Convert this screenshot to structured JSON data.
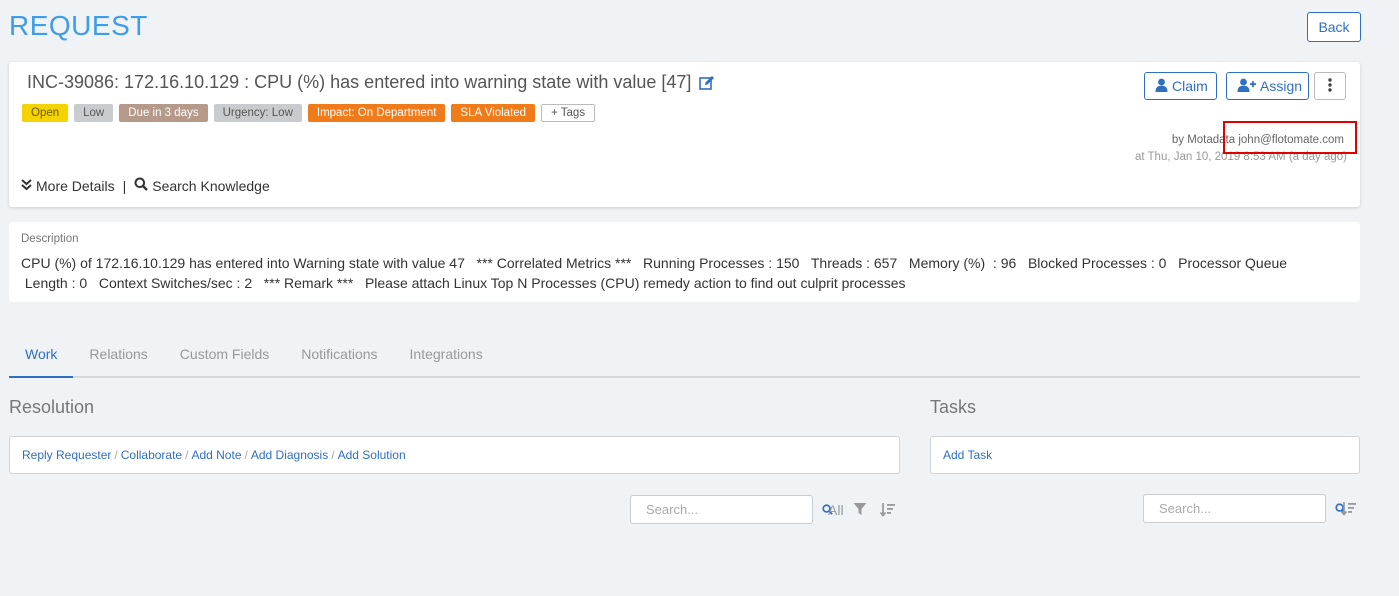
{
  "header": {
    "title": "REQUEST",
    "back_label": "Back"
  },
  "ticket": {
    "title": "INC-39086: 172.16.10.129 : CPU (%) has entered into warning state with value [47]",
    "badges": {
      "status": "Open",
      "priority": "Low",
      "due": "Due in 3 days",
      "urgency": "Urgency: Low",
      "impact": "Impact: On Department",
      "sla": "SLA Violated",
      "tags": "+ Tags"
    },
    "actions": {
      "claim": "Claim",
      "assign": "Assign"
    },
    "by_prefix": "by Motadata",
    "email": "john@flotomate.com",
    "timestamp": "at Thu, Jan 10, 2019 8:53 AM (a day ago)",
    "more_details": "More Details",
    "search_knowledge": "Search Knowledge"
  },
  "description": {
    "label": "Description",
    "text": "CPU (%) of 172.16.10.129 has entered into Warning state with value 47   *** Correlated Metrics ***   Running Processes : 150   Threads : 657   Memory (%)  : 96   Blocked Processes : 0   Processor Queue\n Length : 0   Context Switches/sec : 2   *** Remark ***   Please attach Linux Top N Processes (CPU) remedy action to find out culprit processes"
  },
  "tabs": [
    "Work",
    "Relations",
    "Custom Fields",
    "Notifications",
    "Integrations"
  ],
  "resolution": {
    "title": "Resolution",
    "links": [
      "Reply Requester",
      "Collaborate",
      "Add Note",
      "Add Diagnosis",
      "Add Solution"
    ],
    "search_placeholder": "Search...",
    "filter_label": "All"
  },
  "tasks": {
    "title": "Tasks",
    "add_label": "Add Task",
    "search_placeholder": "Search..."
  },
  "colors": {
    "accent": "#2f6fc2",
    "title_blue": "#3f9ce8",
    "open": "#f4d300",
    "orange": "#ef7b1a",
    "due": "#b59a8a",
    "highlight": "#e00000"
  }
}
